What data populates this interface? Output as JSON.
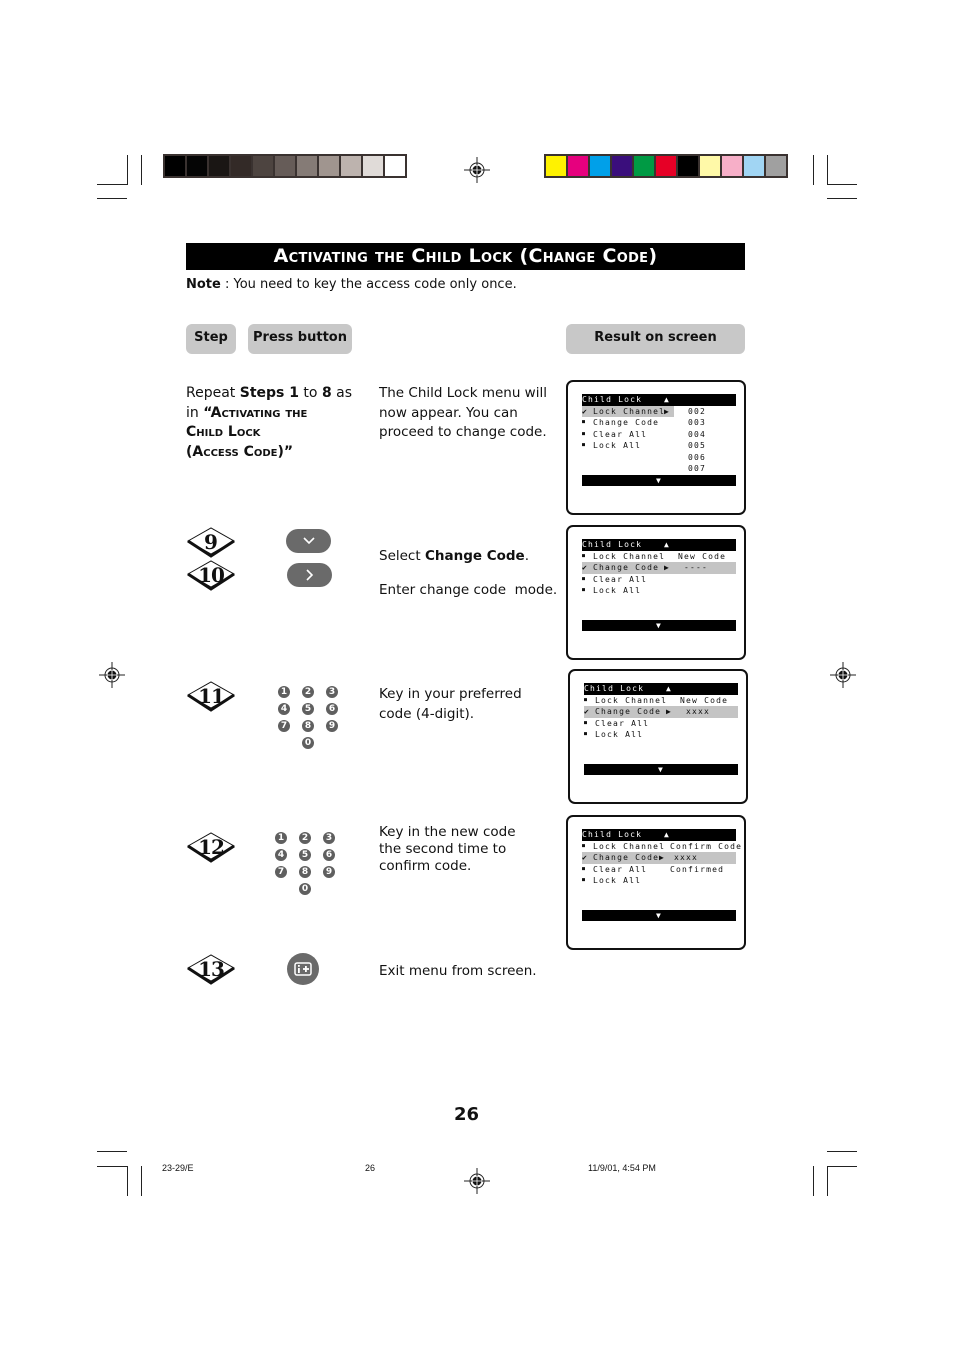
{
  "color_bar_left": [
    "#000000",
    "#050505",
    "#1a1614",
    "#332a27",
    "#4d4440",
    "#665c58",
    "#857b76",
    "#a0958f",
    "#bdb3ae",
    "#e0dbd8",
    "#ffffff"
  ],
  "color_bar_right": [
    "#fff200",
    "#e6007e",
    "#00a0e9",
    "#3a0e7c",
    "#009a44",
    "#e60026",
    "#000000",
    "#fff9a8",
    "#f7afc8",
    "#a1d5f3",
    "#a0a0a0"
  ],
  "title": "Activating the Child Lock (Change Code)",
  "note": {
    "label": "Note",
    "text": " : You need to key the access code only once."
  },
  "headers": {
    "step": "Step",
    "press_button": "Press button",
    "result": "Result on screen"
  },
  "intro": {
    "repeat_prefix": "Repeat ",
    "steps_bold": "Steps 1",
    "to": " to ",
    "eight_bold": "8",
    "as": " as",
    "in": "in ",
    "ref_line1": "“Activating the",
    "ref_line2": "Child Lock",
    "ref_line3": "(Access Code)”",
    "description": "The Child Lock menu will now appear. You can proceed to change code."
  },
  "steps": [
    {
      "num": "9",
      "button": "down-arrow",
      "text_prefix": "Select ",
      "text_bold": "Change Code",
      "text_suffix": "."
    },
    {
      "num": "10",
      "button": "right-arrow",
      "text": "Enter change code  mode."
    },
    {
      "num": "11",
      "button": "number-keys",
      "text": "Key in your preferred code (4-digit)."
    },
    {
      "num": "12",
      "button": "number-keys",
      "text": "Key in the new code the second time to confirm code."
    },
    {
      "num": "13",
      "button": "info-plus",
      "text": "Exit menu from screen."
    }
  ],
  "keypad_digits": [
    "1",
    "2",
    "3",
    "4",
    "5",
    "6",
    "7",
    "8",
    "9",
    "0"
  ],
  "screens": [
    {
      "header": "Child Lock",
      "rows": [
        {
          "mark": "✔",
          "label": "Lock Channel",
          "arrow": "▶",
          "value": "002",
          "hl": true
        },
        {
          "mark": "■",
          "label": "Change Code",
          "arrow": "",
          "value": "003"
        },
        {
          "mark": "■",
          "label": "Clear All",
          "arrow": "",
          "value": "004"
        },
        {
          "mark": "■",
          "label": "Lock All",
          "arrow": "",
          "value": "005"
        },
        {
          "mark": "",
          "label": "",
          "arrow": "",
          "value": "006"
        },
        {
          "mark": "",
          "label": "",
          "arrow": "",
          "value": "007"
        }
      ]
    },
    {
      "header": "Child Lock",
      "rows": [
        {
          "mark": "■",
          "label": "Lock Channel",
          "arrow": "",
          "value": "New Code"
        },
        {
          "mark": "✔",
          "label": "Change Code",
          "arrow": "▶",
          "value": "----",
          "hl": true
        },
        {
          "mark": "■",
          "label": "Clear All",
          "arrow": "",
          "value": ""
        },
        {
          "mark": "■",
          "label": "Lock All",
          "arrow": "",
          "value": ""
        }
      ]
    },
    {
      "header": "Child Lock",
      "rows": [
        {
          "mark": "■",
          "label": "Lock Channel",
          "arrow": "",
          "value": "New Code"
        },
        {
          "mark": "✔",
          "label": "Change Code",
          "arrow": "▶",
          "value": "xxxx",
          "hl": true
        },
        {
          "mark": "■",
          "label": "Clear All",
          "arrow": "",
          "value": ""
        },
        {
          "mark": "■",
          "label": "Lock All",
          "arrow": "",
          "value": ""
        }
      ]
    },
    {
      "header": "Child Lock",
      "rows": [
        {
          "mark": "■",
          "label": "Lock Channel",
          "arrow": "",
          "value": "Confirm Code"
        },
        {
          "mark": "✔",
          "label": "Change Code",
          "arrow": "▶",
          "value": "xxxx",
          "hl": true
        },
        {
          "mark": "■",
          "label": "Clear All",
          "arrow": "",
          "value": "Confirmed"
        },
        {
          "mark": "■",
          "label": "Lock All",
          "arrow": "",
          "value": ""
        }
      ]
    }
  ],
  "screen_up_arrow": "▲",
  "screen_down_arrow": "▼",
  "page_number": "26",
  "footer": {
    "left": "23-29/E",
    "center": "26",
    "right": "11/9/01, 4:54 PM"
  }
}
